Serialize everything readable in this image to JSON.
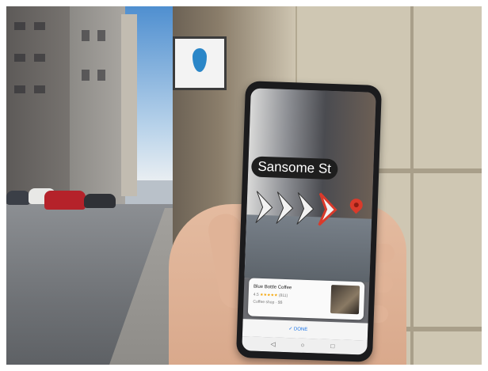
{
  "scene": {
    "storefront_sign_icon": "blue-bottle-drop-icon",
    "accent_red": "#d93a2b",
    "accent_blue": "#1a73e8"
  },
  "ar_view": {
    "street_name": "Sansome St",
    "direction_chevrons": 4
  },
  "place_card": {
    "title": "Blue Bottle Coffee",
    "rating": "4.5",
    "stars": "★★★★★",
    "review_count": "(811)",
    "meta": "Coffee shop · $$"
  },
  "actions": {
    "done_label": "DONE",
    "done_icon": "checkmark-icon"
  },
  "system_nav": {
    "back": "◁",
    "home": "○",
    "recents": "□"
  }
}
